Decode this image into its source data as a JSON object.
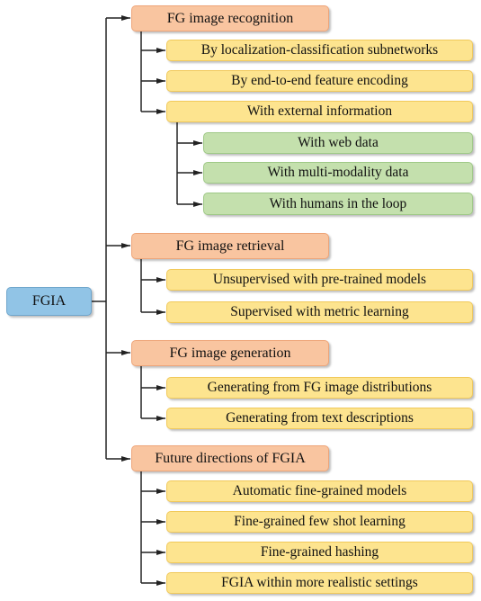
{
  "colors": {
    "root": "#91c4e6",
    "level1": "#f9c5a0",
    "level2": "#fde48f",
    "level3": "#c4e0ad",
    "connector": "#222222"
  },
  "root": {
    "label": "FGIA"
  },
  "branches": [
    {
      "label": "FG image recognition",
      "children": [
        {
          "label": "By localization-classification subnetworks"
        },
        {
          "label": "By end-to-end feature encoding"
        },
        {
          "label": "With external information",
          "children": [
            {
              "label": "With web data"
            },
            {
              "label": "With multi-modality data"
            },
            {
              "label": "With humans in the loop"
            }
          ]
        }
      ]
    },
    {
      "label": "FG image retrieval",
      "children": [
        {
          "label": "Unsupervised with pre-trained models"
        },
        {
          "label": "Supervised with metric learning"
        }
      ]
    },
    {
      "label": "FG image generation",
      "children": [
        {
          "label": "Generating from FG image distributions"
        },
        {
          "label": "Generating from text descriptions"
        }
      ]
    },
    {
      "label": "Future directions of FGIA",
      "children": [
        {
          "label": "Automatic fine-grained models"
        },
        {
          "label": "Fine-grained few shot learning"
        },
        {
          "label": "Fine-grained hashing"
        },
        {
          "label": "FGIA within more realistic settings"
        }
      ]
    }
  ]
}
